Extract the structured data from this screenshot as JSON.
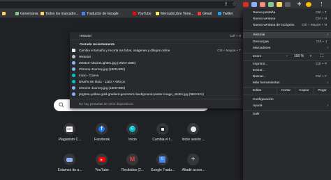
{
  "colors": {
    "background": "#202124",
    "menu_bg": "#292a2d",
    "toolbar_bg": "#35363a",
    "divider": "#3c3d41",
    "highlight": "#3c3d41",
    "text": "#e8eaed",
    "muted": "#9aa0a6"
  },
  "toolbar": {
    "icons": [
      "share-icon",
      "bookmark-star-icon",
      "extension-icon",
      "profile-icon",
      "menu-kebab-icon"
    ]
  },
  "bookmarks": [
    {
      "label": "",
      "icon": "folder-icon"
    },
    {
      "label": "Growmania",
      "icon": "growmania-icon"
    },
    {
      "label": "Todos los marcador...",
      "icon": "folder-icon"
    },
    {
      "label": "Traductor de Google",
      "icon": "translate-icon"
    },
    {
      "label": "YouTube",
      "icon": "youtube-icon"
    },
    {
      "label": "MercadoLibre Vene...",
      "icon": "mercadolibre-icon"
    },
    {
      "label": "Gmail",
      "icon": "gmail-icon"
    },
    {
      "label": "Twitter",
      "icon": "twitter-icon"
    }
  ],
  "history_menu": {
    "header": {
      "label": "Historial",
      "shortcut": "Ctrl + H"
    },
    "recently_closed_label": "Cerrado recientemente",
    "items": [
      {
        "label": "Cambia el tamaño y recorta tus fotos, imágenes y dibujos online",
        "shortcut": "Ctrl + Mayús + T",
        "icon": "page-icon"
      },
      {
        "label": "Historial",
        "shortcut": "",
        "icon": "history-icon"
      },
      {
        "label": "200323-AbLineLight01.jpg (1920×1080)",
        "shortcut": "",
        "icon": "image-icon"
      },
      {
        "label": "Chrome-Journey.jpg (1600×800)",
        "shortcut": "",
        "icon": "image-icon"
      },
      {
        "label": "Inicio - Canva",
        "shortcut": "",
        "icon": "canva-icon"
      },
      {
        "label": "Diseño sin título - 1200 × 600 px",
        "shortcut": "",
        "icon": "canva-icon"
      },
      {
        "label": "Chrome-Journey.jpg (1600×800)",
        "shortcut": "",
        "icon": "image-icon"
      },
      {
        "label": "pngtree-yellow-gold-gradient-geometric-background-poster-image_49461.jpg (960×521)",
        "shortcut": "",
        "icon": "image-icon"
      }
    ],
    "footer": "No hay pestañas de otros dispositivos."
  },
  "chrome_menu": {
    "new_tab": {
      "label": "Nueva pestaña",
      "shortcut": "Ctrl + T"
    },
    "new_window": {
      "label": "Nueva ventana",
      "shortcut": "Ctrl + N"
    },
    "incognito": {
      "label": "Nueva ventana de incógnito",
      "shortcut": "Ctrl + Mayús + N"
    },
    "history": {
      "label": "Historial"
    },
    "downloads": {
      "label": "Descargas",
      "shortcut": "Ctrl + J"
    },
    "bookmarks": {
      "label": "Marcadores"
    },
    "zoom": {
      "label": "Zoom",
      "minus": "−",
      "value": "100 %",
      "plus": "+",
      "fullscreen_icon": "fullscreen-icon"
    },
    "print": {
      "label": "Imprimir...",
      "shortcut": "Ctrl + P"
    },
    "cast": {
      "label": "Enviar..."
    },
    "find": {
      "label": "Buscar...",
      "shortcut": "Ctrl + F"
    },
    "more_tools": {
      "label": "Más herramientas"
    },
    "edit": {
      "label": "Editar",
      "cut": "Cortar",
      "copy": "Copiar",
      "paste": "Pegar"
    },
    "settings": {
      "label": "Configuración"
    },
    "help": {
      "label": "Ayuda"
    },
    "exit": {
      "label": "Salir"
    }
  },
  "shortcuts": [
    {
      "label": "Plagiarism C...",
      "icon": "plagiarism-icon"
    },
    {
      "label": "Facebook",
      "icon": "facebook-icon"
    },
    {
      "label": "Inicio",
      "icon": "canva-icon"
    },
    {
      "label": "Cambia el t...",
      "icon": "resize-icon"
    },
    {
      "label": "Inicie sesión ...",
      "icon": "login-icon"
    },
    {
      "label": "Estamos de a...",
      "icon": "community-icon"
    },
    {
      "label": "YouTube",
      "icon": "youtube-icon"
    },
    {
      "label": "Recibidos (2...",
      "icon": "gmail-icon"
    },
    {
      "label": "Google Tradu...",
      "icon": "translate-icon"
    },
    {
      "label": "Añadir acces...",
      "icon": "add-icon"
    }
  ]
}
